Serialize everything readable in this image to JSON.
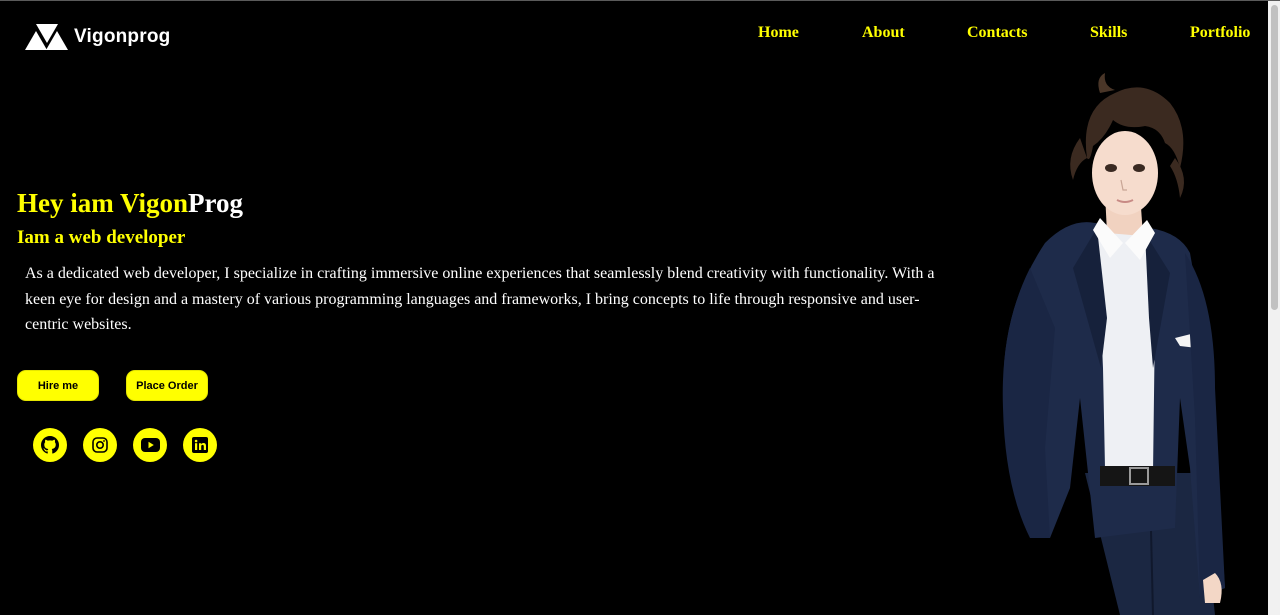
{
  "header": {
    "brand": "Vigonprog",
    "nav": [
      "Home",
      "About",
      "Contacts",
      "Skills",
      "Portfolio"
    ]
  },
  "hero": {
    "title_part1": "Hey iam Vigon",
    "title_part2": "Prog",
    "subtitle": "Iam a web developer",
    "description": "As a dedicated web developer, I specialize in crafting immersive online experiences that seamlessly blend creativity with functionality. With a keen eye for design and a mastery of various programming languages and frameworks, I bring concepts to life through responsive and user-centric websites."
  },
  "buttons": {
    "hire": "Hire me",
    "order": "Place Order"
  },
  "social": [
    {
      "icon": "github-icon"
    },
    {
      "icon": "instagram-icon"
    },
    {
      "icon": "youtube-icon"
    },
    {
      "icon": "linkedin-icon"
    }
  ],
  "colors": {
    "accent": "#ffff00",
    "background": "#000000",
    "text": "#ffffff"
  }
}
